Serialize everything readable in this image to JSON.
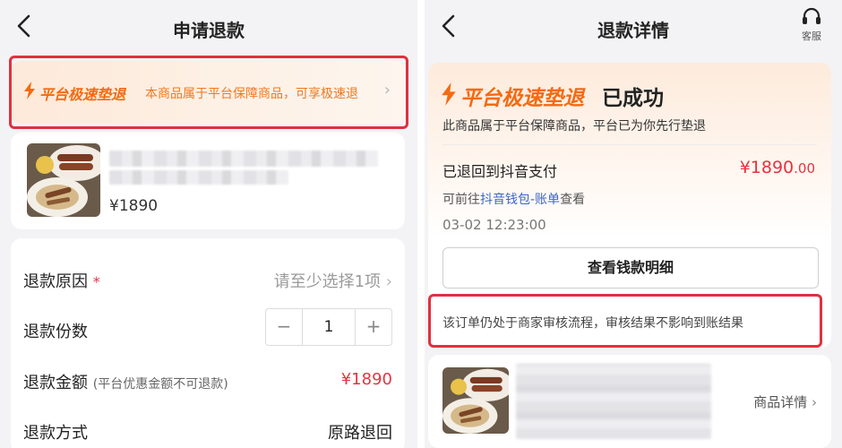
{
  "left": {
    "nav": {
      "back_glyph": "<",
      "title": "申请退款"
    },
    "banner": {
      "icon": "lightning-icon",
      "brand": "平台极速垫退",
      "description": "本商品属于平台保障商品，可享极速退",
      "chevron": "›"
    },
    "product": {
      "price": "¥1890"
    },
    "form": {
      "reason_label": "退款原因",
      "required_mark": "*",
      "reason_placeholder": "请至少选择1项",
      "reason_chevron": "›",
      "quantity_label": "退款份数",
      "minus": "−",
      "quantity": "1",
      "plus": "+",
      "amount_label": "退款金额",
      "amount_note": "(平台优惠金额不可退款)",
      "amount": "¥1890",
      "method_label": "退款方式",
      "method_value": "原路退回"
    }
  },
  "right": {
    "nav": {
      "back_glyph": "<",
      "title": "退款详情",
      "service_label": "客服",
      "service_icon": "headset-icon"
    },
    "status_card": {
      "icon": "lightning-icon",
      "brand": "平台极速垫退",
      "status": "已成功",
      "notice": "此商品属于平台保障商品，平台已为你先行垫退",
      "refund_target": "已退回到抖音支付",
      "amount_main": "¥1890",
      "amount_decimal": ".00",
      "link_prefix": "可前往",
      "link_text": "抖音钱包-账单",
      "link_suffix": "查看",
      "time": "03-02 12:23:00",
      "detail_button": "查看钱款明细",
      "review_notice": "该订单仍处于商家审核流程，审核结果不影响到账结果"
    },
    "product": {
      "details_link": "商品详情",
      "chevron": "›"
    }
  },
  "colors": {
    "accent_orange": "#f46a12",
    "price_red": "#e8323f",
    "highlight_box": "#e0303f",
    "link_blue": "#3b66c4"
  }
}
